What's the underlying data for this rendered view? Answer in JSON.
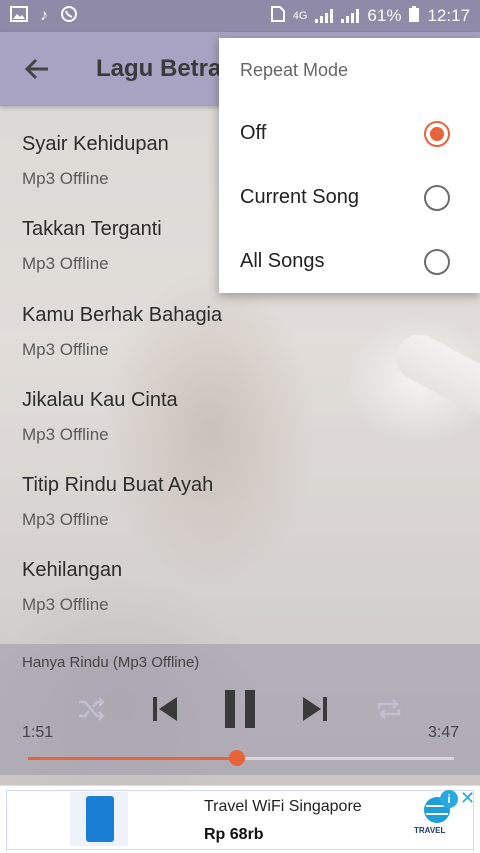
{
  "status_bar": {
    "network": "4G",
    "battery": "61%",
    "time": "12:17"
  },
  "toolbar": {
    "title": "Lagu Betra"
  },
  "songs": [
    {
      "title": "Syair Kehidupan",
      "subtitle": "Mp3 Offline"
    },
    {
      "title": "Takkan Terganti",
      "subtitle": "Mp3 Offline"
    },
    {
      "title": "Kamu Berhak Bahagia",
      "subtitle": "Mp3 Offline"
    },
    {
      "title": "Jikalau Kau Cinta",
      "subtitle": "Mp3 Offline"
    },
    {
      "title": "Titip Rindu Buat Ayah",
      "subtitle": "Mp3 Offline"
    },
    {
      "title": "Kehilangan",
      "subtitle": "Mp3 Offline"
    }
  ],
  "player": {
    "now_playing": "Hanya Rindu (Mp3 Offline)",
    "elapsed": "1:51",
    "duration": "3:47",
    "progress_fraction": 0.49,
    "state": "playing"
  },
  "repeat_menu": {
    "title": "Repeat Mode",
    "options": [
      {
        "label": "Off",
        "selected": true
      },
      {
        "label": "Current Song",
        "selected": false
      },
      {
        "label": "All Songs",
        "selected": false
      }
    ]
  },
  "ad": {
    "title": "Travel WiFi Singapore",
    "price": "Rp 68rb",
    "brand": "TRAVEL"
  },
  "colors": {
    "accent": "#e8633a",
    "toolbar": "#a8a3c2",
    "status_bar": "#8e8aa8"
  }
}
